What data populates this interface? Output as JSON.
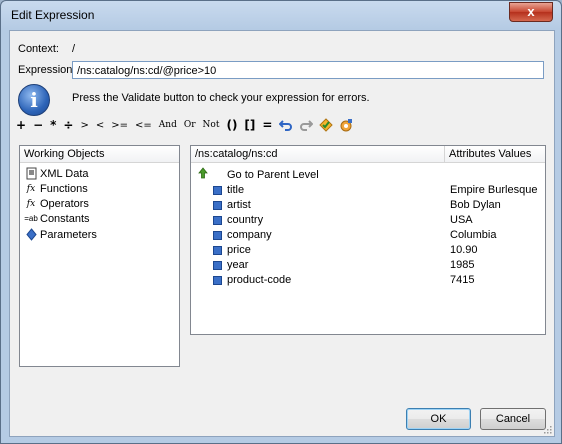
{
  "window": {
    "title": "Edit Expression",
    "close_label": "x"
  },
  "context": {
    "label": "Context:",
    "value": "/"
  },
  "expression": {
    "label": "Expression:",
    "value": "/ns:catalog/ns:cd/@price>10"
  },
  "info": {
    "text": "Press the Validate button to check your expression for errors."
  },
  "operators": [
    "+",
    "−",
    "*",
    "÷",
    ">",
    "<",
    ">=",
    "<=",
    "And",
    "Or",
    "Not",
    "()",
    "[]",
    "="
  ],
  "toolbar_icons": [
    "undo-icon",
    "redo-icon",
    "validate-icon",
    "settings-icon"
  ],
  "working_objects": {
    "header": "Working Objects",
    "items": [
      {
        "label": "XML Data",
        "icon": "xml-data-icon"
      },
      {
        "label": "Functions",
        "icon": "functions-icon"
      },
      {
        "label": "Operators",
        "icon": "operators-icon"
      },
      {
        "label": "Constants",
        "icon": "constants-icon"
      },
      {
        "label": "Parameters",
        "icon": "parameters-icon"
      }
    ]
  },
  "xml_view": {
    "path_header": "/ns:catalog/ns:cd",
    "values_header": "Attributes Values",
    "parent_label": "Go to Parent Level",
    "rows": [
      {
        "name": "title",
        "value": "Empire Burlesque"
      },
      {
        "name": "artist",
        "value": "Bob Dylan"
      },
      {
        "name": "country",
        "value": "USA"
      },
      {
        "name": "company",
        "value": "Columbia"
      },
      {
        "name": "price",
        "value": "10.90"
      },
      {
        "name": "year",
        "value": "1985"
      },
      {
        "name": "product-code",
        "value": "7415"
      }
    ]
  },
  "buttons": {
    "ok": "OK",
    "cancel": "Cancel"
  }
}
